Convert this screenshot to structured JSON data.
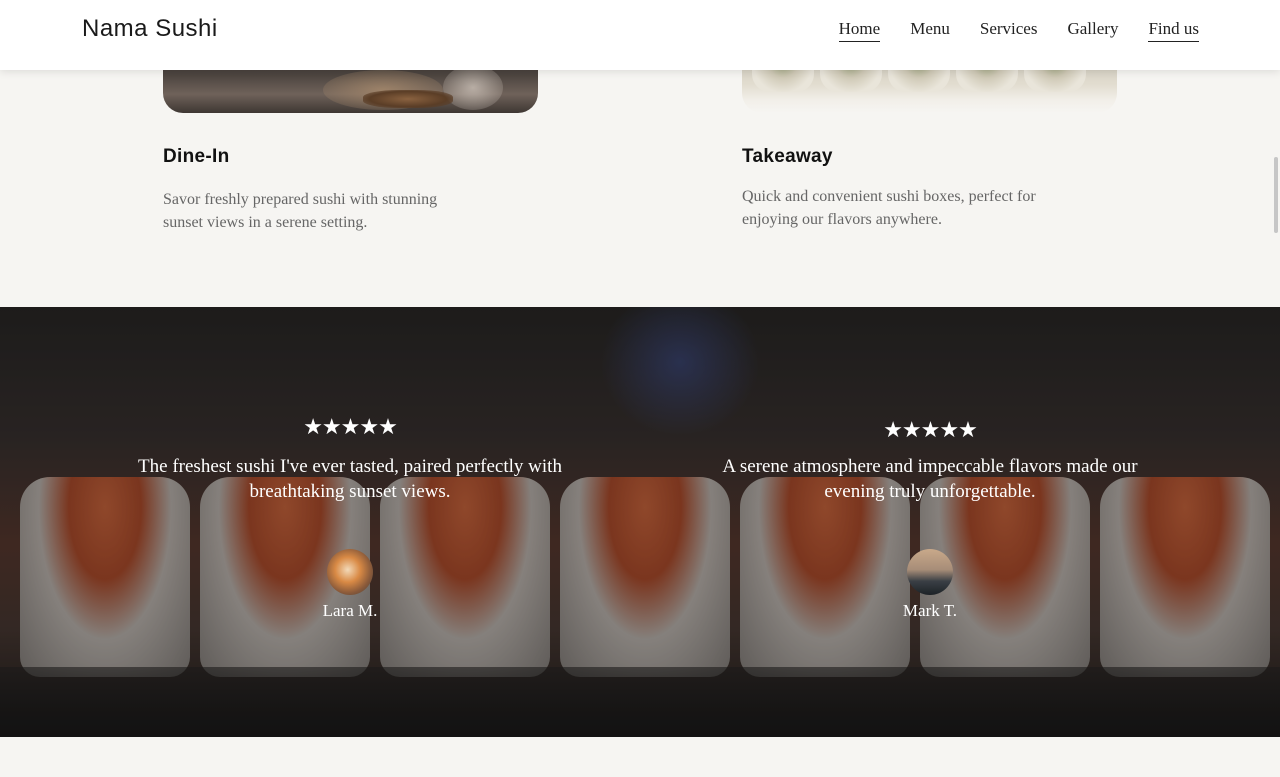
{
  "header": {
    "brand": "Nama Sushi",
    "nav": [
      "Home",
      "Menu",
      "Services",
      "Gallery",
      "Find us"
    ]
  },
  "services": [
    {
      "title": "Dine-In",
      "text": "Savor freshly prepared sushi with stunning sunset views in a serene setting."
    },
    {
      "title": "Takeaway",
      "text": "Quick and convenient sushi boxes, perfect for enjoying our flavors anywhere."
    }
  ],
  "testimonials": [
    {
      "stars": "★★★★★",
      "rating": 5,
      "quote": "The freshest sushi I've ever tasted, paired perfectly with breathtaking sunset views.",
      "name": "Lara M."
    },
    {
      "stars": "★★★★★",
      "rating": 5,
      "quote": "A serene atmosphere and impeccable flavors made our evening truly unforgettable.",
      "name": "Mark T."
    }
  ]
}
